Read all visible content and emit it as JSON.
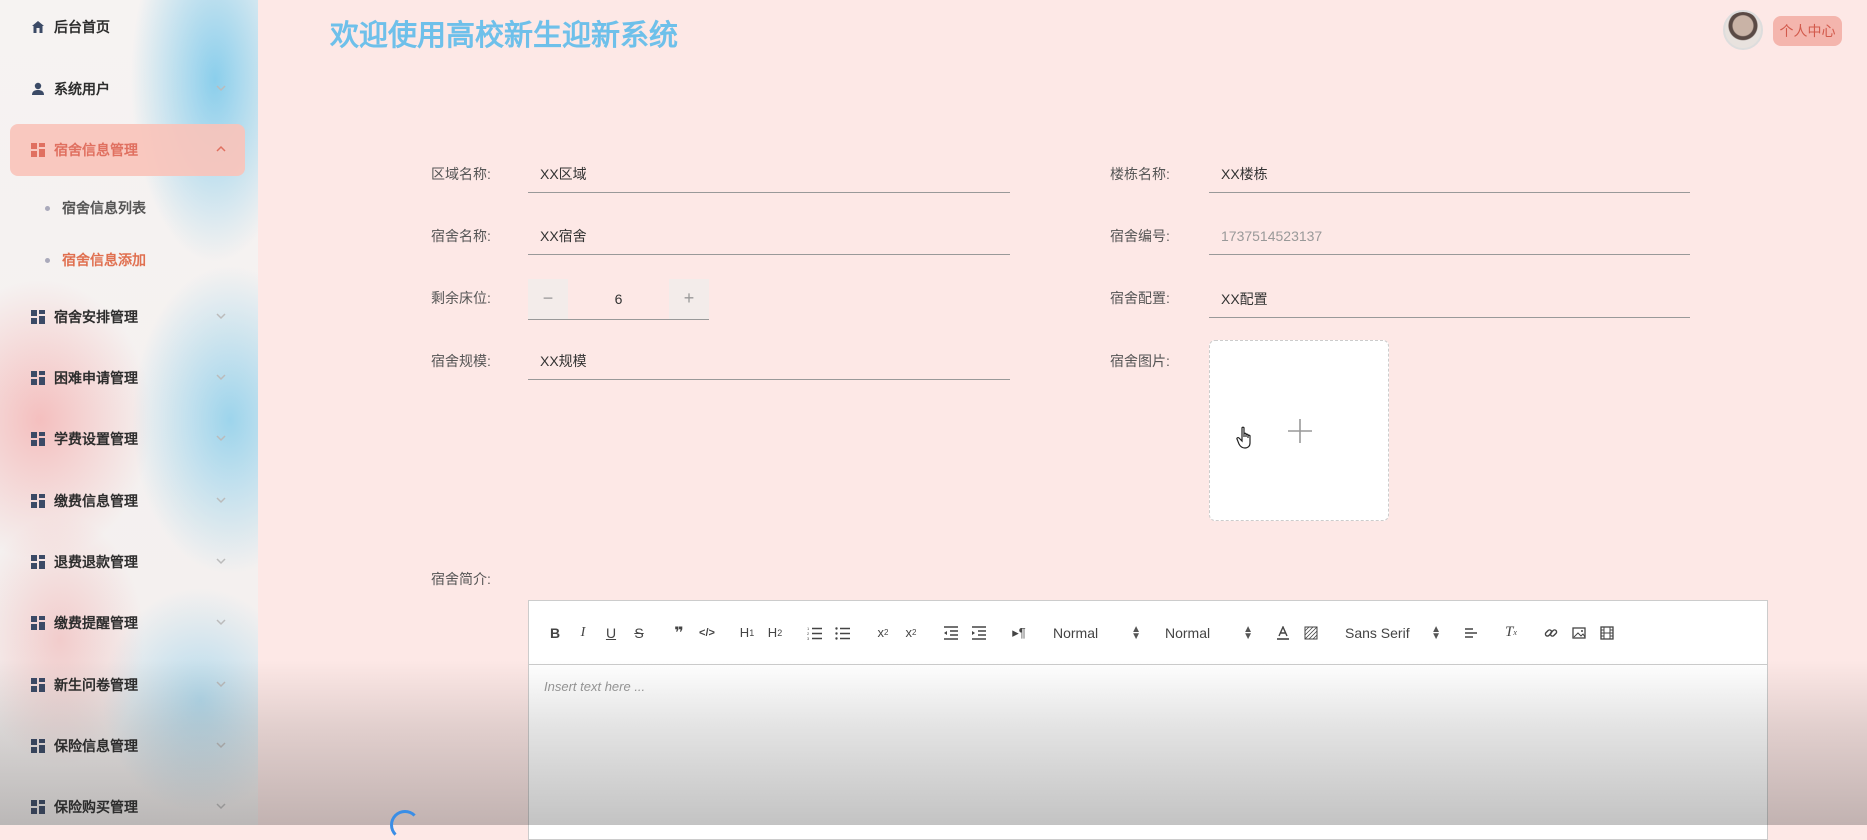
{
  "app": {
    "title": "欢迎使用高校新生迎新系统",
    "user_center": "个人中心"
  },
  "sidebar": {
    "items": [
      {
        "label": "后台首页",
        "icon": "home-icon"
      },
      {
        "label": "系统用户",
        "icon": "user-icon"
      },
      {
        "label": "宿舍信息管理",
        "icon": "grid-icon",
        "active": true
      },
      {
        "label": "宿舍安排管理",
        "icon": "grid-icon"
      },
      {
        "label": "困难申请管理",
        "icon": "grid-icon"
      },
      {
        "label": "学费设置管理",
        "icon": "grid-icon"
      },
      {
        "label": "缴费信息管理",
        "icon": "grid-icon"
      },
      {
        "label": "退费退款管理",
        "icon": "grid-icon"
      },
      {
        "label": "缴费提醒管理",
        "icon": "grid-icon"
      },
      {
        "label": "新生问卷管理",
        "icon": "grid-icon"
      },
      {
        "label": "保险信息管理",
        "icon": "grid-icon"
      },
      {
        "label": "保险购买管理",
        "icon": "grid-icon"
      }
    ],
    "sub_items": [
      {
        "label": "宿舍信息列表"
      },
      {
        "label": "宿舍信息添加",
        "active": true
      }
    ]
  },
  "form": {
    "area_label": "区域名称:",
    "area_value": "XX区域",
    "building_label": "楼栋名称:",
    "building_value": "XX楼栋",
    "dorm_name_label": "宿舍名称:",
    "dorm_name_value": "XX宿舍",
    "dorm_no_label": "宿舍编号:",
    "dorm_no_value": "1737514523137",
    "beds_label": "剩余床位:",
    "beds_value": "6",
    "config_label": "宿舍配置:",
    "config_value": "XX配置",
    "scale_label": "宿舍规模:",
    "scale_value": "XX规模",
    "image_label": "宿舍图片:",
    "intro_label": "宿舍简介:"
  },
  "editor": {
    "placeholder": "Insert text here ...",
    "header_select": "Normal",
    "size_select": "Normal",
    "font_select": "Sans Serif"
  },
  "colors": {
    "title": "#6ec0ea",
    "accent": "#e07060",
    "background": "#fde8e6"
  }
}
